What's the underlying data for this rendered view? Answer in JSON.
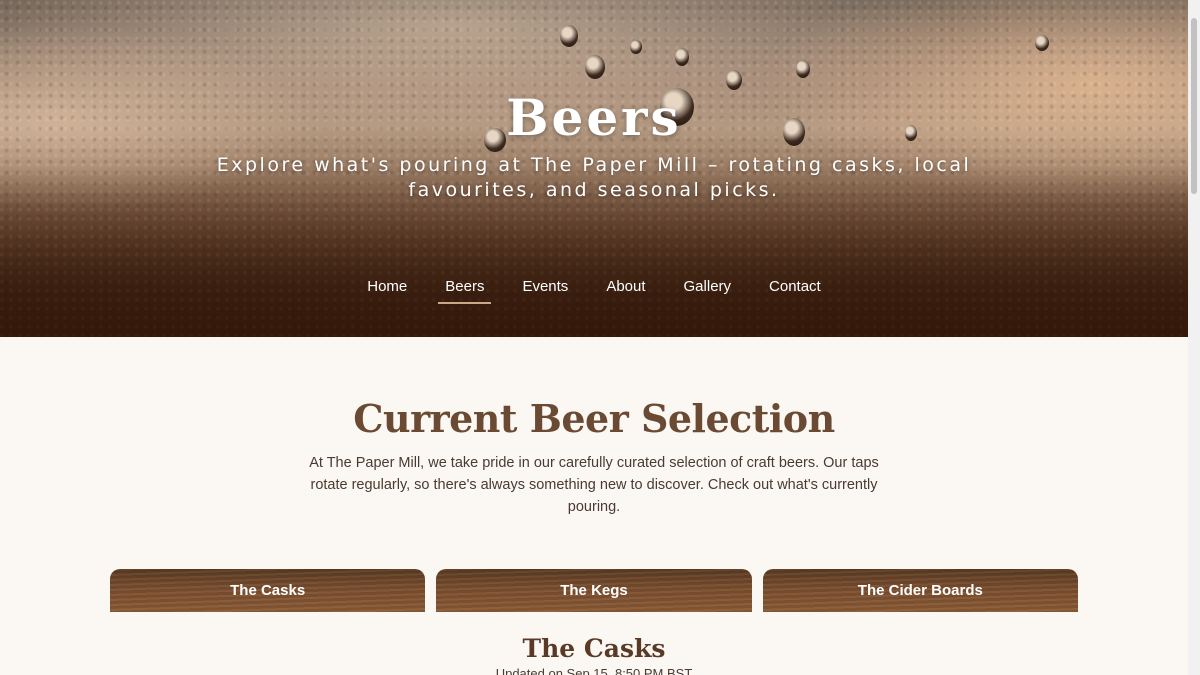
{
  "hero": {
    "title": "Beers",
    "subtitle": "Explore what's pouring at The Paper Mill – rotating casks, local favourites, and seasonal picks."
  },
  "nav": {
    "items": [
      {
        "label": "Home",
        "active": false
      },
      {
        "label": "Beers",
        "active": true
      },
      {
        "label": "Events",
        "active": false
      },
      {
        "label": "About",
        "active": false
      },
      {
        "label": "Gallery",
        "active": false
      },
      {
        "label": "Contact",
        "active": false
      }
    ]
  },
  "selection": {
    "title": "Current Beer Selection",
    "intro": "At The Paper Mill, we take pride in our carefully curated selection of craft beers. Our taps rotate regularly, so there's always something new to discover. Check out what's currently pouring."
  },
  "tabs": [
    {
      "label": "The Casks"
    },
    {
      "label": "The Kegs"
    },
    {
      "label": "The Cider Boards"
    }
  ],
  "panel": {
    "title": "The Casks",
    "updated": "Updated on Sep 15, 8:50 PM BST"
  },
  "colors": {
    "heading": "#6b4a33",
    "background": "#fbf8f4",
    "tab": "#7a4e2e",
    "nav_underline": "#c9a98a"
  }
}
